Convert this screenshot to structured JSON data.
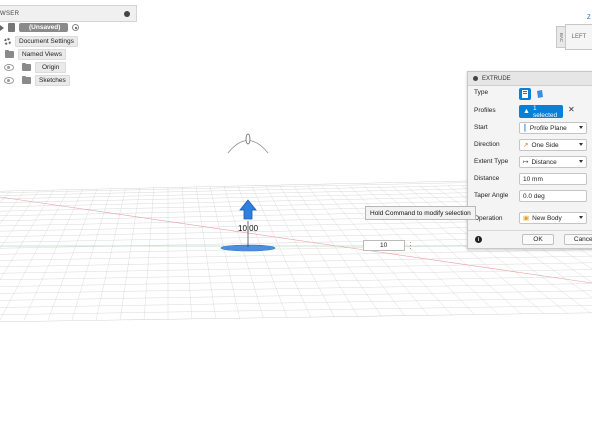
{
  "browser": {
    "title": "WSER",
    "root_label": "(Unsaved)",
    "items": [
      {
        "label": "Document Settings"
      },
      {
        "label": "Named Views"
      },
      {
        "label": "Origin"
      },
      {
        "label": "Sketches"
      }
    ]
  },
  "viewcube": {
    "face_front": "LEFT",
    "face_side": "BAC",
    "axis": "Z"
  },
  "extrude": {
    "title": "EXTRUDE",
    "rows": {
      "type": {
        "label": "Type"
      },
      "profiles": {
        "label": "Profiles",
        "value": "1 selected"
      },
      "start": {
        "label": "Start",
        "value": "Profile Plane"
      },
      "direction": {
        "label": "Direction",
        "value": "One Side"
      },
      "extent_type": {
        "label": "Extent Type",
        "value": "Distance"
      },
      "distance": {
        "label": "Distance",
        "value": "10 mm"
      },
      "taper": {
        "label": "Taper Angle",
        "value": "0.0 deg"
      },
      "operation": {
        "label": "Operation",
        "value": "New Body"
      }
    },
    "ok_label": "OK",
    "cancel_label": "Cancel"
  },
  "canvas": {
    "tooltip": "Hold Command to modify selection",
    "dimension_label": "10.00",
    "distance_input": "10"
  },
  "colors": {
    "accent": "#0a7fd6",
    "selection": "#4a8fe0",
    "grid": "#c8c8c8"
  }
}
